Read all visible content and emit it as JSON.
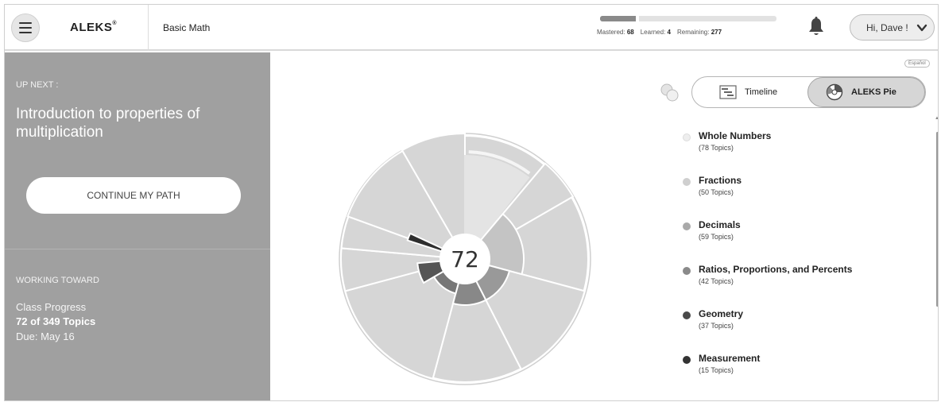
{
  "header": {
    "app_name": "ALEKS",
    "trademark": "®",
    "course": "Basic Math",
    "progress": {
      "mastered_label": "Mastered:",
      "mastered": "68",
      "learned_label": "Learned:",
      "learned": "4",
      "remaining_label": "Remaining:",
      "remaining": "277"
    },
    "user_greeting": "Hi, Dave !",
    "icons": {
      "menu": "menu-icon",
      "bell": "bell-icon",
      "user_menu": "chevron-down-icon"
    }
  },
  "left_panel": {
    "up_next_label": "UP NEXT :",
    "topic_title": "Introduction to properties of multiplication",
    "continue_button": "CONTINUE MY PATH",
    "working_toward_label": "WORKING TOWARD",
    "class_progress_label": "Class Progress",
    "class_progress_value": "72 of 349 Topics",
    "due": "Due: May 16"
  },
  "right_panel": {
    "language_link": "Español",
    "view_toggle": {
      "timeline_label": "Timeline",
      "pie_label": "ALEKS Pie",
      "selected": "ALEKS Pie"
    },
    "pie_center": "72",
    "legend": [
      {
        "name": "Whole Numbers",
        "topics": "(78 Topics)",
        "color": "#eeeeee"
      },
      {
        "name": "Fractions",
        "topics": "(50 Topics)",
        "color": "#cfcfcf"
      },
      {
        "name": "Decimals",
        "topics": "(59 Topics)",
        "color": "#a9a9a9"
      },
      {
        "name": "Ratios, Proportions, and Percents",
        "topics": "(42 Topics)",
        "color": "#8a8a8a"
      },
      {
        "name": "Geometry",
        "topics": "(37 Topics)",
        "color": "#4a4a4a"
      },
      {
        "name": "Measurement",
        "topics": "(15 Topics)",
        "color": "#333333"
      }
    ]
  },
  "colors": {
    "panel": "#a0a0a0",
    "pie_fill": "#d6d6d6",
    "pie_mastered": "#999999",
    "pie_highlight": "#2e2e2e"
  }
}
